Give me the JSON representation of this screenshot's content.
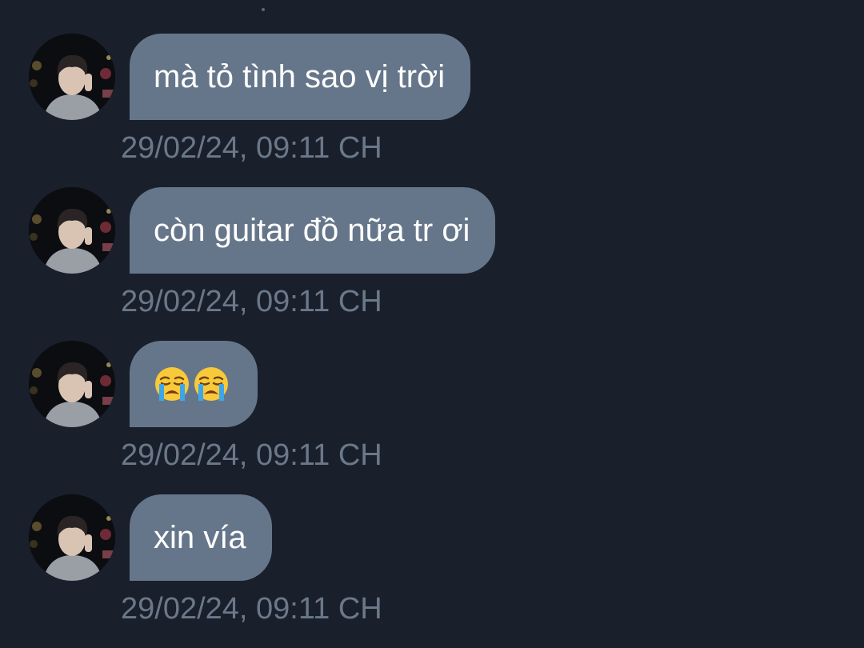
{
  "colors": {
    "background": "#19202b",
    "bubble": "#66768a",
    "bubble_text": "#ffffff",
    "timestamp": "#6b7889"
  },
  "messages": [
    {
      "text": "mà tỏ tình sao vị trời",
      "timestamp": "29/02/24, 09:11 CH"
    },
    {
      "text": "còn guitar đồ nữa tr ơi",
      "timestamp": "29/02/24, 09:11 CH"
    },
    {
      "emojis": [
        "loudly-crying-face-emoji",
        "loudly-crying-face-emoji"
      ],
      "timestamp": "29/02/24, 09:11 CH"
    },
    {
      "text": "xin vía",
      "timestamp": "29/02/24, 09:11 CH"
    }
  ]
}
